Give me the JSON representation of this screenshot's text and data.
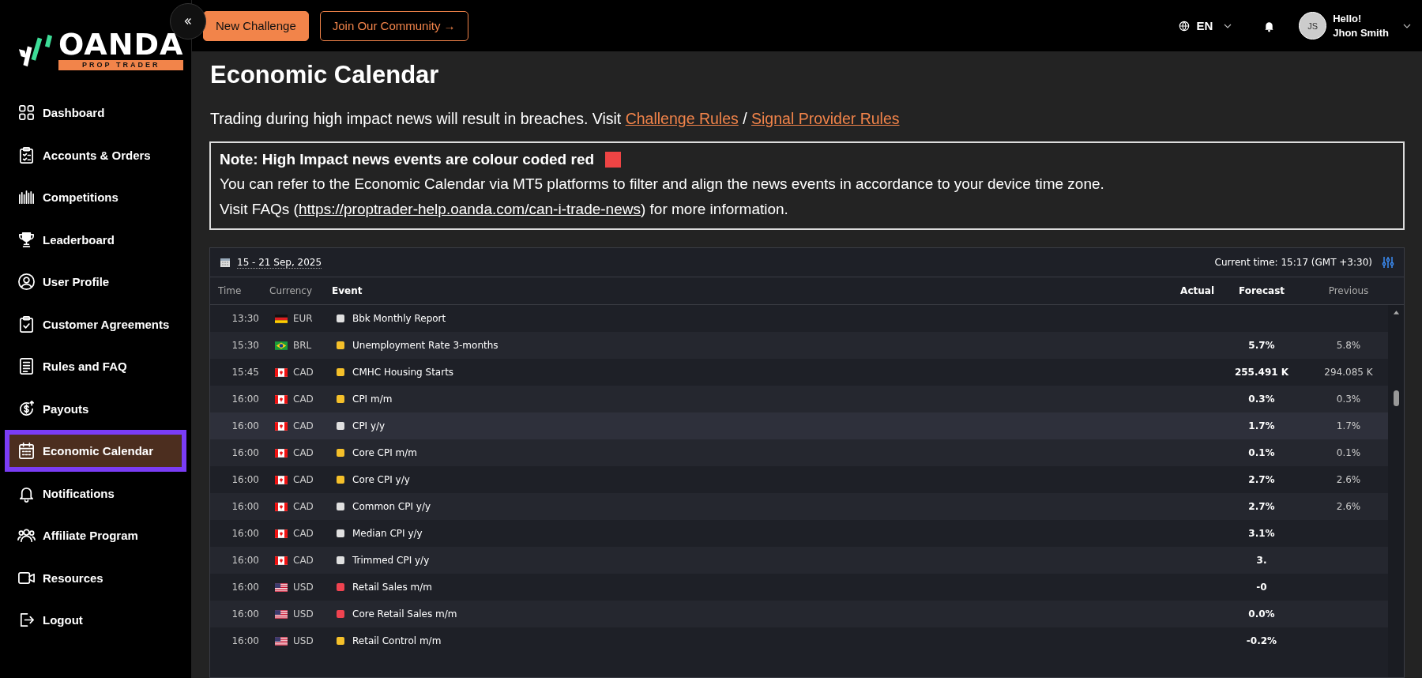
{
  "brand": {
    "name": "OANDA",
    "tagline": "PROP TRADER"
  },
  "topbar": {
    "buttons": [
      {
        "label": "New Challenge",
        "kind": "primary"
      },
      {
        "label": "Join Our Community →",
        "kind": "outline"
      }
    ],
    "language": "EN",
    "user": {
      "initials": "JS",
      "greeting": "Hello!",
      "name": "Jhon Smith"
    }
  },
  "sidebar": {
    "items": [
      {
        "label": "Dashboard",
        "selected": false
      },
      {
        "label": "Accounts & Orders",
        "selected": false
      },
      {
        "label": "Competitions",
        "selected": false
      },
      {
        "label": "Leaderboard",
        "selected": false
      },
      {
        "label": "User Profile",
        "selected": false
      },
      {
        "label": "Customer Agreements",
        "selected": false
      },
      {
        "label": "Rules and FAQ",
        "selected": false
      },
      {
        "label": "Payouts",
        "selected": false
      },
      {
        "label": "Economic Calendar",
        "selected": true
      },
      {
        "label": "Notifications",
        "selected": false
      },
      {
        "label": "Affiliate Program",
        "selected": false
      },
      {
        "label": "Resources",
        "selected": false
      },
      {
        "label": "Logout",
        "selected": false
      }
    ]
  },
  "page": {
    "title": "Economic Calendar",
    "intro": {
      "text": "Trading during high impact news will result in breaches. Visit",
      "links": [
        "Challenge Rules",
        "Signal Provider Rules"
      ],
      "separator": "/"
    },
    "note": {
      "title": "Note: High Impact news events are colour coded red",
      "color": "#ef4444",
      "line": "You can refer to the Economic Calendar via MT5 platforms to filter and align the news events in accordance to your device time zone.",
      "faq_prefix": "Visit FAQs (",
      "faq_link": "https://proptrader-help.oanda.com/can-i-trade-news",
      "faq_suffix": ") for more information."
    }
  },
  "calendar": {
    "date_range": "15 - 21 Sep, 2025",
    "current_time": "Current time: 15:17 (GMT +3:30)",
    "columns": [
      {
        "label": "Time",
        "emphasized": false
      },
      {
        "label": "Currency",
        "emphasized": false
      },
      {
        "label": "Event",
        "emphasized": true
      },
      {
        "label": "Actual",
        "emphasized": true
      },
      {
        "label": "Forecast",
        "emphasized": true
      },
      {
        "label": "Previous",
        "emphasized": false
      }
    ],
    "rows": [
      {
        "time": "13:30",
        "kind": "germany",
        "currency": "EUR",
        "color": "#e0e0e0",
        "event": "Bbk Monthly Report",
        "highlighted": false
      },
      {
        "time": "15:30",
        "kind": "brazil",
        "currency": "BRL",
        "color": "#f5c02a",
        "event": "Unemployment Rate 3-months",
        "forecast": "5.7%",
        "previous": "5.8%",
        "highlighted": false
      },
      {
        "time": "15:45",
        "kind": "canada",
        "currency": "CAD",
        "color": "#f5c02a",
        "event": "CMHC Housing Starts",
        "forecast": "255.491 K",
        "previous": "294.085 K",
        "highlighted": false
      },
      {
        "time": "16:00",
        "kind": "canada",
        "currency": "CAD",
        "color": "#f5c02a",
        "event": "CPI m/m",
        "forecast": "0.3%",
        "previous": "0.3%",
        "highlighted": false
      },
      {
        "time": "16:00",
        "kind": "canada",
        "currency": "CAD",
        "color": "#e0e0e0",
        "event": "CPI y/y",
        "forecast": "1.7%",
        "previous": "1.7%",
        "highlighted": true
      },
      {
        "time": "16:00",
        "kind": "canada",
        "currency": "CAD",
        "color": "#f5c02a",
        "event": "Core CPI m/m",
        "forecast": "0.1%",
        "previous": "0.1%",
        "highlighted": false
      },
      {
        "time": "16:00",
        "kind": "canada",
        "currency": "CAD",
        "color": "#f5c02a",
        "event": "Core CPI y/y",
        "forecast": "2.7%",
        "previous": "2.6%",
        "highlighted": false
      },
      {
        "time": "16:00",
        "kind": "canada",
        "currency": "CAD",
        "color": "#e0e0e0",
        "event": "Common CPI y/y",
        "forecast": "2.7%",
        "previous": "2.6%",
        "highlighted": false
      },
      {
        "time": "16:00",
        "kind": "canada",
        "currency": "CAD",
        "color": "#e0e0e0",
        "event": "Median CPI y/y",
        "forecast": "3.1%",
        "highlighted": false
      },
      {
        "time": "16:00",
        "kind": "canada",
        "currency": "CAD",
        "color": "#e0e0e0",
        "event": "Trimmed CPI y/y",
        "forecast": "3.",
        "highlighted": false
      },
      {
        "time": "16:00",
        "kind": "usa",
        "currency": "USD",
        "color": "#ef4350",
        "event": "Retail Sales m/m",
        "forecast": "-0",
        "highlighted": false
      },
      {
        "time": "16:00",
        "kind": "usa",
        "currency": "USD",
        "color": "#ef4350",
        "event": "Core Retail Sales m/m",
        "forecast": "0.0%",
        "highlighted": false
      },
      {
        "time": "16:00",
        "kind": "usa",
        "currency": "USD",
        "color": "#f5c02a",
        "event": "Retail Control m/m",
        "forecast": "-0.2%",
        "highlighted": false
      }
    ]
  }
}
